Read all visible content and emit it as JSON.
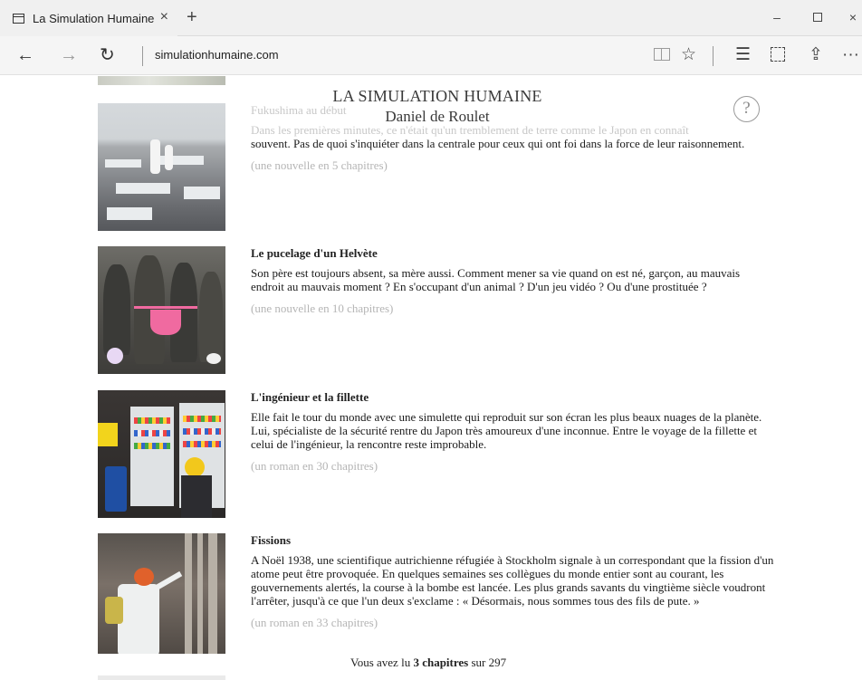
{
  "browser": {
    "tab_title": "La Simulation Humaine",
    "tab_close": "×",
    "new_tab": "+",
    "address": "simulationhumaine.com",
    "controls": {
      "back": "←",
      "forward": "→",
      "refresh": "↻",
      "favorite": "☆",
      "hub": "☰",
      "share": "⇪",
      "more": "···",
      "minimize": "–",
      "close": "×"
    }
  },
  "site": {
    "title": "LA SIMULATION HUMAINE",
    "author": "Daniel de Roulet",
    "help": "?"
  },
  "stories": [
    {
      "title": "Fukushima au début",
      "summary_overlap": "Dans les premières minutes, ce n'était qu'un tremblement de terre comme le Japon en connaît",
      "summary": "souvent. Pas de quoi s'inquiéter dans la centrale pour ceux qui ont foi dans la force de leur raisonnement.",
      "meta": "(une nouvelle en 5 chapitres)"
    },
    {
      "title": "Le pucelage d'un Helvète",
      "summary": "Son père est toujours absent, sa mère aussi. Comment mener sa vie quand on est né, garçon, au mauvais endroit au mauvais moment ? En s'occupant d'un animal ? D'un jeu vidéo ? Ou d'une prostituée ?",
      "meta": "(une nouvelle en 10 chapitres)"
    },
    {
      "title": "L'ingénieur et la fillette",
      "summary": "Elle fait le tour du monde avec une simulette qui reproduit sur son écran les plus beaux nuages de la planète. Lui, spécialiste de la sécurité rentre du Japon très amoureux d'une inconnue. Entre le voyage de la fillette et celui de l'ingénieur, la rencontre reste improbable.",
      "meta": "(un roman en 30 chapitres)"
    },
    {
      "title": "Fissions",
      "summary": "A Noël 1938, une scientifique autrichienne réfugiée à Stockholm signale à un correspondant que la fission d'un atome peut être provoquée. En quelques semaines ses collègues du monde entier sont au courant, les gouvernements alertés, la course à la bombe est lancée. Les plus grands savants du vingtième siècle voudront l'arrêter, jusqu'à ce que l'un deux s'exclame : « Désormais, nous sommes tous des fils de pute. »",
      "meta": "(un roman en 33 chapitres)"
    }
  ],
  "counter": {
    "prefix": "Vous avez lu",
    "count": "3 chapitres",
    "suffix": "sur 297"
  }
}
